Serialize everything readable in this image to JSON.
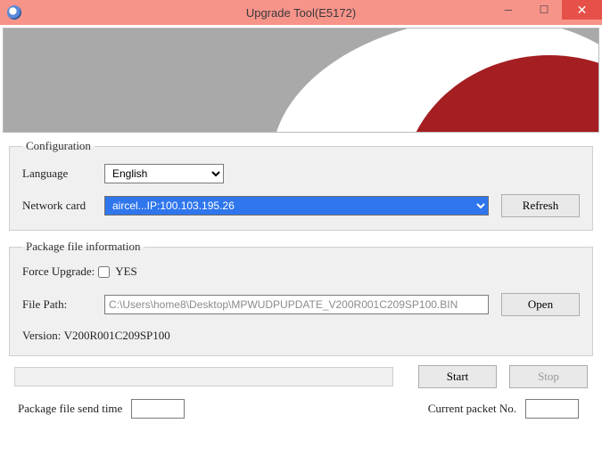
{
  "window": {
    "title": "Upgrade Tool(E5172)"
  },
  "configuration": {
    "legend": "Configuration",
    "language_label": "Language",
    "language_value": "English",
    "network_label": "Network card",
    "network_value": "aircel...IP:100.103.195.26",
    "refresh_label": "Refresh"
  },
  "package": {
    "legend": "Package file information",
    "force_label": "Force Upgrade:",
    "force_yes": "YES",
    "path_label": "File Path:",
    "path_value": "C:\\Users\\home8\\Desktop\\MPWUDPUPDATE_V200R001C209SP100.BIN",
    "open_label": "Open",
    "version_label": "Version:",
    "version_value": "V200R001C209SP100"
  },
  "actions": {
    "start_label": "Start",
    "stop_label": "Stop"
  },
  "footer": {
    "send_time_label": "Package file send time",
    "send_time_value": "",
    "packet_no_label": "Current packet No.",
    "packet_no_value": ""
  }
}
